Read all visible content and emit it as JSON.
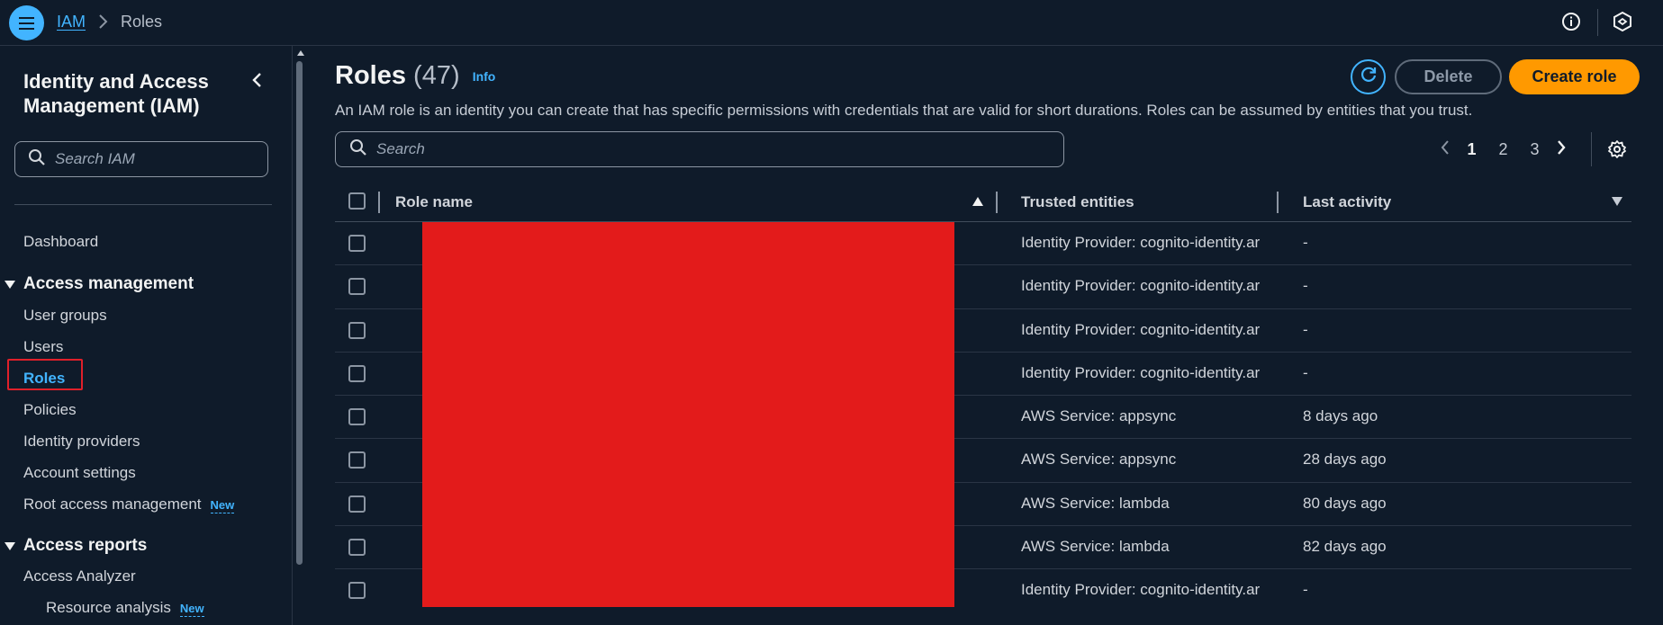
{
  "topbar": {
    "breadcrumb_root": "IAM",
    "breadcrumb_current": "Roles",
    "menu_icon": "hamburger-menu-icon",
    "info_icon": "info-circle-icon",
    "cloudshell_icon": "cloudshell-icon"
  },
  "sidebar": {
    "title": "Identity and Access Management (IAM)",
    "search_placeholder": "Search IAM",
    "dashboard": "Dashboard",
    "section_access_management": "Access management",
    "items": [
      {
        "label": "User groups"
      },
      {
        "label": "Users"
      },
      {
        "label": "Roles",
        "active": true
      },
      {
        "label": "Policies"
      },
      {
        "label": "Identity providers"
      },
      {
        "label": "Account settings"
      },
      {
        "label": "Root access management",
        "badge": "New"
      }
    ],
    "section_access_reports": "Access reports",
    "reports_items": [
      {
        "label": "Access Analyzer"
      },
      {
        "label": "Resource analysis",
        "badge": "New"
      }
    ]
  },
  "header": {
    "title": "Roles",
    "count": "(47)",
    "info_link": "Info",
    "description": "An IAM role is an identity you can create that has specific permissions with credentials that are valid for short durations. Roles can be assumed by entities that you trust.",
    "delete_label": "Delete",
    "create_label": "Create role",
    "search_placeholder": "Search"
  },
  "pagination": {
    "pages": [
      "1",
      "2",
      "3"
    ],
    "current": "1"
  },
  "table": {
    "columns": [
      "Role name",
      "Trusted entities",
      "Last activity"
    ],
    "rows": [
      {
        "trusted": "Identity Provider: cognito-identity.ar",
        "activity": "-"
      },
      {
        "trusted": "Identity Provider: cognito-identity.ar",
        "activity": "-"
      },
      {
        "trusted": "Identity Provider: cognito-identity.ar",
        "activity": "-"
      },
      {
        "trusted": "Identity Provider: cognito-identity.ar",
        "activity": "-"
      },
      {
        "trusted": "AWS Service: appsync",
        "activity": "8 days ago"
      },
      {
        "trusted": "AWS Service: appsync",
        "activity": "28 days ago"
      },
      {
        "trusted": "AWS Service: lambda",
        "activity": "80 days ago"
      },
      {
        "trusted": "AWS Service: lambda",
        "activity": "82 days ago"
      },
      {
        "trusted": "Identity Provider: cognito-identity.ar",
        "activity": "-"
      }
    ]
  },
  "colors": {
    "accent": "#42b4ff",
    "primary_button": "#ff9900",
    "redaction": "#e31b1b",
    "highlight_box": "#e0202a",
    "background": "#0f1b2a"
  }
}
